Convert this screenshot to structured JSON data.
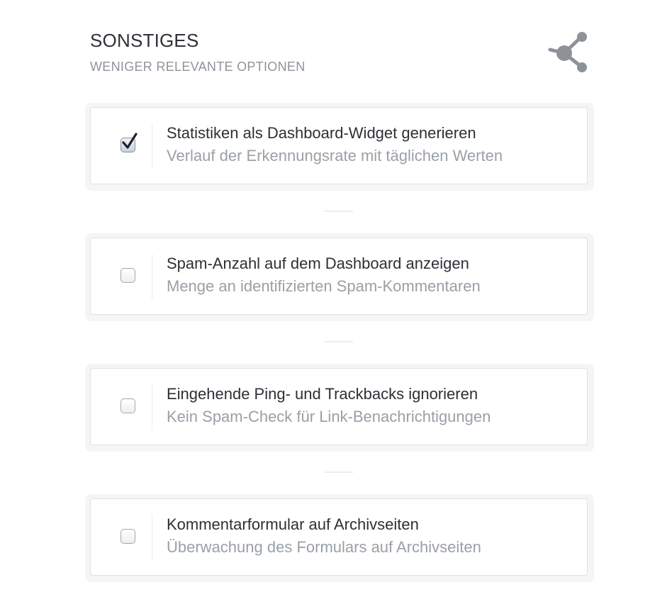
{
  "section": {
    "title": "SONSTIGES",
    "subtitle": "WENIGER RELEVANTE OPTIONEN",
    "icon": "share-icon"
  },
  "options": [
    {
      "label": "Statistiken als Dashboard-Widget generieren",
      "description": "Verlauf der Erkennungsrate mit täglichen Werten",
      "checked": true
    },
    {
      "label": "Spam-Anzahl auf dem Dashboard anzeigen",
      "description": "Menge an identifizierten Spam-Kommentaren",
      "checked": false
    },
    {
      "label": "Eingehende Ping- und Trackbacks ignorieren",
      "description": "Kein Spam-Check für Link-Benachrichtigungen",
      "checked": false
    },
    {
      "label": "Kommentarformular auf Archivseiten",
      "description": "Überwachung des Formulars auf Archivseiten",
      "checked": false
    }
  ],
  "colors": {
    "title": "#2f3136",
    "subtitle": "#8e949c",
    "label": "#2d3035",
    "description": "#9aa0a7",
    "icon": "#8c9298"
  }
}
